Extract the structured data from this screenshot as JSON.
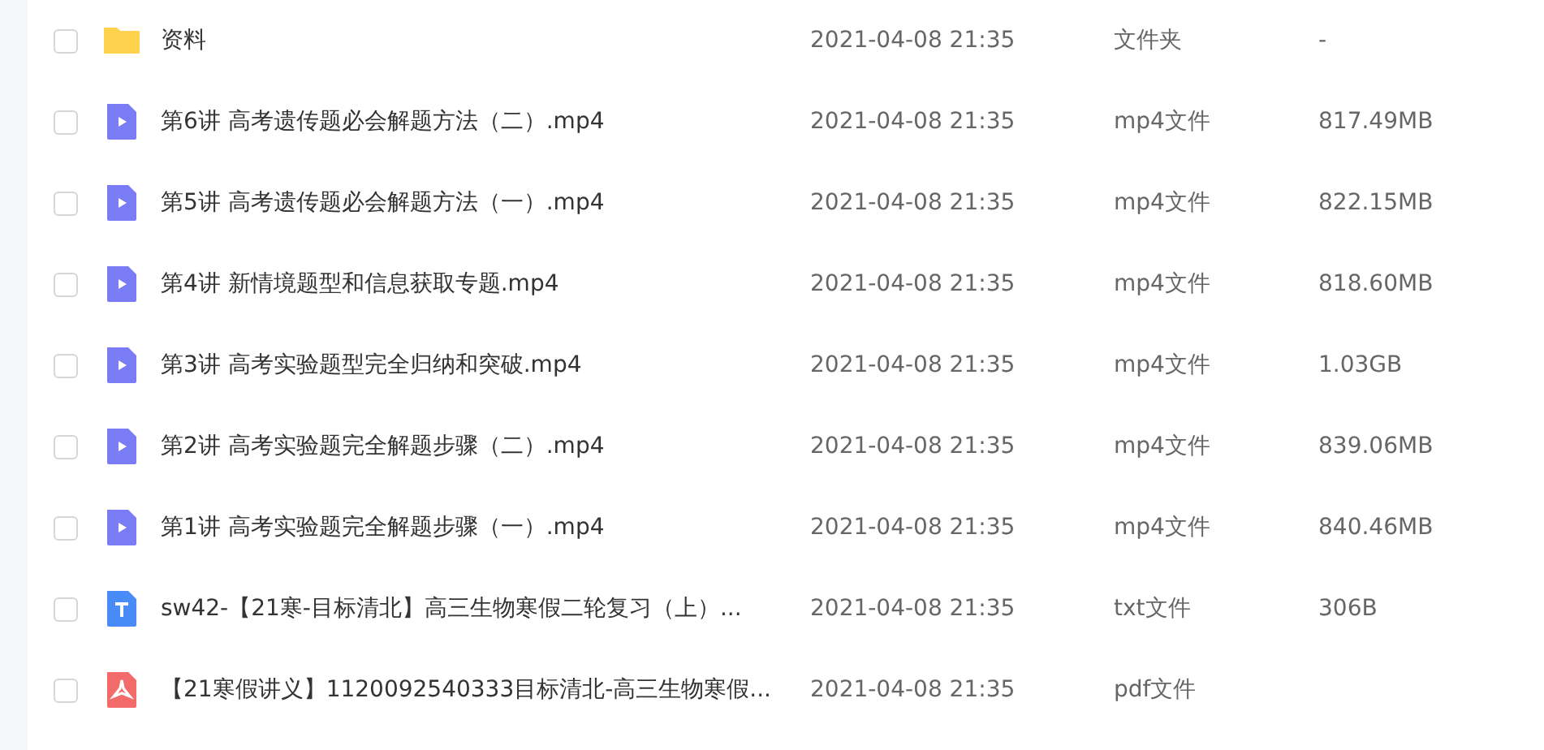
{
  "files": [
    {
      "kind": "folder",
      "name": "资料",
      "checked": false,
      "modified": "2021-04-08 21:35",
      "type": "文件夹",
      "size": "-"
    },
    {
      "kind": "video",
      "name": "第6讲 高考遗传题必会解题方法（二）.mp4",
      "checked": false,
      "modified": "2021-04-08 21:35",
      "type": "mp4文件",
      "size": "817.49MB"
    },
    {
      "kind": "video",
      "name": "第5讲 高考遗传题必会解题方法（一）.mp4",
      "checked": false,
      "modified": "2021-04-08 21:35",
      "type": "mp4文件",
      "size": "822.15MB"
    },
    {
      "kind": "video",
      "name": "第4讲 新情境题型和信息获取专题.mp4",
      "checked": false,
      "modified": "2021-04-08 21:35",
      "type": "mp4文件",
      "size": "818.60MB"
    },
    {
      "kind": "video",
      "name": "第3讲 高考实验题型完全归纳和突破.mp4",
      "checked": false,
      "modified": "2021-04-08 21:35",
      "type": "mp4文件",
      "size": "1.03GB"
    },
    {
      "kind": "video",
      "name": "第2讲 高考实验题完全解题步骤（二）.mp4",
      "checked": false,
      "modified": "2021-04-08 21:35",
      "type": "mp4文件",
      "size": "839.06MB"
    },
    {
      "kind": "video",
      "name": "第1讲 高考实验题完全解题步骤（一）.mp4",
      "checked": false,
      "modified": "2021-04-08 21:35",
      "type": "mp4文件",
      "size": "840.46MB"
    },
    {
      "kind": "text",
      "name": "sw42-【21寒-目标清北】高三生物寒假二轮复习（上）...",
      "checked": false,
      "modified": "2021-04-08 21:35",
      "type": "txt文件",
      "size": "306B"
    },
    {
      "kind": "pdf",
      "name": "【21寒假讲义】1120092540333目标清北-高三生物寒假...",
      "checked": false,
      "modified": "2021-04-08 21:35",
      "type": "pdf文件"
    }
  ]
}
